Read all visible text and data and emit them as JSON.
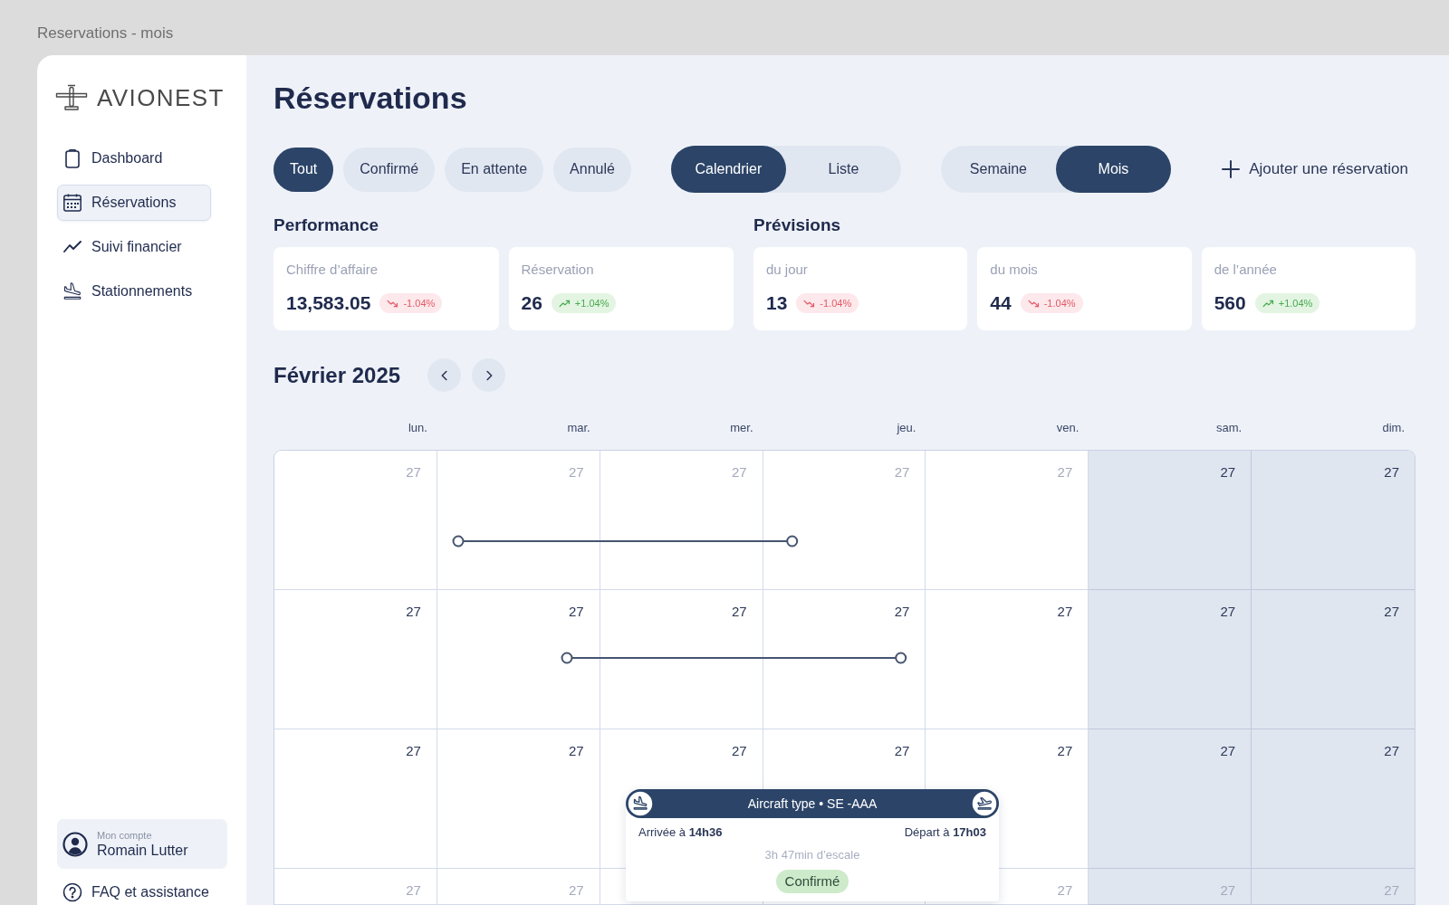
{
  "window": {
    "title": "Reservations - mois"
  },
  "sidebar": {
    "logo": "AVIONEST",
    "items": [
      {
        "label": "Dashboard",
        "selected": false
      },
      {
        "label": "Réservations",
        "selected": true
      },
      {
        "label": "Suivi financier",
        "selected": false
      },
      {
        "label": "Stationnements",
        "selected": false
      }
    ],
    "account": {
      "caption": "Mon compte",
      "name": "Romain Lutter"
    },
    "help": {
      "label": "FAQ et assistance"
    }
  },
  "header": {
    "title": "Réservations"
  },
  "filters": [
    {
      "label": "Tout",
      "selected": true
    },
    {
      "label": "Confirmé",
      "selected": false
    },
    {
      "label": "En attente",
      "selected": false
    },
    {
      "label": "Annulé",
      "selected": false
    }
  ],
  "view_toggle": [
    {
      "label": "Calendrier",
      "selected": true
    },
    {
      "label": "Liste",
      "selected": false
    }
  ],
  "period_toggle": [
    {
      "label": "Semaine",
      "selected": false
    },
    {
      "label": "Mois",
      "selected": true
    }
  ],
  "add_button": {
    "label": "Ajouter une réservation"
  },
  "performance": {
    "title": "Performance",
    "cards": [
      {
        "label": "Chiffre d’affaire",
        "value": "13,583.05",
        "change": "-1.04%",
        "rising": false
      },
      {
        "label": "Réservation",
        "value": "26",
        "change": "+1.04%",
        "rising": true
      }
    ]
  },
  "forecast": {
    "title": "Prévisions",
    "cards": [
      {
        "label": "du jour",
        "value": "13",
        "change": "-1.04%",
        "rising": false
      },
      {
        "label": "du mois",
        "value": "44",
        "change": "-1.04%",
        "rising": false
      },
      {
        "label": "de l’année",
        "value": "560",
        "change": "+1.04%",
        "rising": true
      }
    ]
  },
  "calendar": {
    "title": "Février 2025",
    "weekdays": [
      {
        "label": "lun.",
        "weekend": false
      },
      {
        "label": "mar.",
        "weekend": false
      },
      {
        "label": "mer.",
        "weekend": false
      },
      {
        "label": "jeu.",
        "weekend": false
      },
      {
        "label": "ven.",
        "weekend": false
      },
      {
        "label": "sam.",
        "weekend": true
      },
      {
        "label": "dim.",
        "weekend": true
      }
    ],
    "rows": [
      {
        "cells": [
          {
            "day": "27",
            "muted": true,
            "booked_am": false,
            "booked_pm": false
          },
          {
            "day": "27",
            "muted": true,
            "booked_am": true,
            "booked_pm": true
          },
          {
            "day": "27",
            "muted": true,
            "booked_am": true,
            "booked_pm": true
          },
          {
            "day": "27",
            "muted": true,
            "booked_am": true,
            "booked_pm": false
          },
          {
            "day": "27",
            "muted": true,
            "booked_am": false,
            "booked_pm": false
          },
          {
            "day": "27",
            "muted": false,
            "booked_am": false,
            "booked_pm": false
          },
          {
            "day": "27",
            "muted": false,
            "booked_am": false,
            "booked_pm": false
          }
        ]
      },
      {
        "cells": [
          {
            "day": "27",
            "muted": false,
            "booked_am": false,
            "booked_pm": false
          },
          {
            "day": "27",
            "muted": false,
            "booked_am": false,
            "booked_pm": true
          },
          {
            "day": "27",
            "muted": false,
            "booked_am": true,
            "booked_pm": true
          },
          {
            "day": "27",
            "muted": false,
            "booked_am": true,
            "booked_pm": true
          },
          {
            "day": "27",
            "muted": false,
            "booked_am": false,
            "booked_pm": false
          },
          {
            "day": "27",
            "muted": false,
            "booked_am": false,
            "booked_pm": false
          },
          {
            "day": "27",
            "muted": false,
            "booked_am": false,
            "booked_pm": false
          }
        ]
      },
      {
        "cells": [
          {
            "day": "27",
            "muted": false,
            "booked_am": false,
            "booked_pm": false
          },
          {
            "day": "27",
            "muted": false,
            "booked_am": false,
            "booked_pm": false
          },
          {
            "day": "27",
            "muted": false,
            "booked_am": false,
            "booked_pm": false
          },
          {
            "day": "27",
            "muted": false,
            "booked_am": false,
            "booked_pm": false
          },
          {
            "day": "27",
            "muted": false,
            "booked_am": false,
            "booked_pm": false
          },
          {
            "day": "27",
            "muted": false,
            "booked_am": false,
            "booked_pm": false
          },
          {
            "day": "27",
            "muted": false,
            "booked_am": false,
            "booked_pm": false
          }
        ]
      },
      {
        "cells": [
          {
            "day": "27",
            "muted": true,
            "booked_am": false,
            "booked_pm": false
          },
          {
            "day": "27",
            "muted": true,
            "booked_am": false,
            "booked_pm": false
          },
          {
            "booked_am": false,
            "booked_pm": false
          },
          {
            "booked_am": false,
            "booked_pm": false
          },
          {
            "day": "27",
            "muted": true,
            "booked_am": false,
            "booked_pm": false
          },
          {
            "day": "27",
            "muted": true,
            "booked_am": false,
            "booked_pm": false
          },
          {
            "day": "27",
            "muted": true,
            "booked_am": false,
            "booked_pm": false
          }
        ]
      }
    ],
    "popup": {
      "title": "Aircraft type • SE -AAA",
      "arrival": "Arrivée à **14h36**",
      "departure": "Départ à **17h03**",
      "stopover": "3h 47min d’escale",
      "status": {
        "label": "Confirmé",
        "kind": "confirmed"
      }
    }
  }
}
